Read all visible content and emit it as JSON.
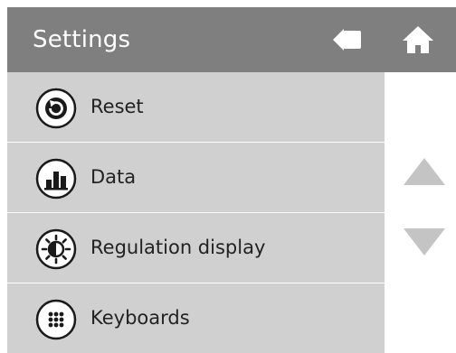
{
  "header": {
    "title": "Settings",
    "back_icon": "arrow-left-icon",
    "home_icon": "home-icon",
    "background": "#7f7f7f"
  },
  "menu": {
    "items": [
      {
        "label": "Reset",
        "icon": "reset-icon"
      },
      {
        "label": "Data",
        "icon": "bar-chart-icon"
      },
      {
        "label": "Regulation display",
        "icon": "brightness-icon"
      },
      {
        "label": "Keyboards",
        "icon": "keypad-icon"
      }
    ],
    "item_background": "#d0d0d0"
  },
  "scroll": {
    "up_icon": "triangle-up-icon",
    "down_icon": "triangle-down-icon"
  }
}
